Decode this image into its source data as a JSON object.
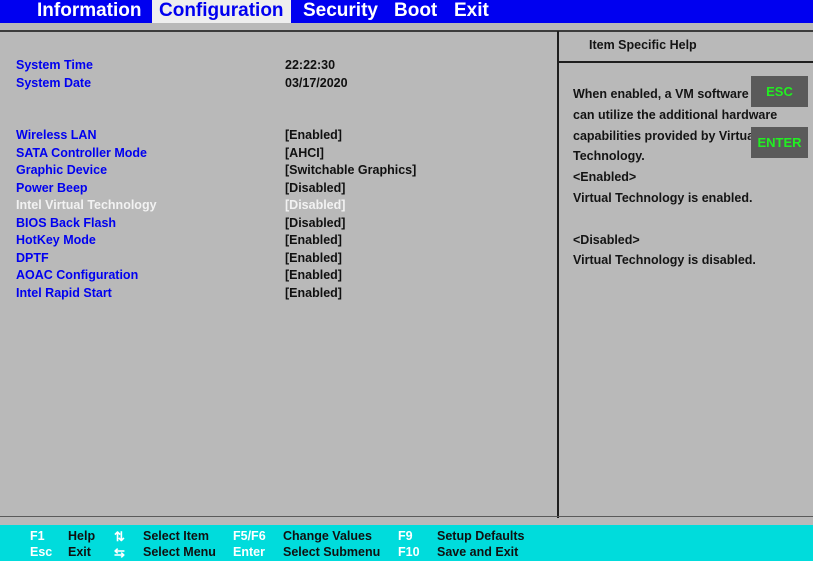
{
  "menu": {
    "tabs": [
      {
        "label": "Information",
        "active": false
      },
      {
        "label": "Configuration",
        "active": true
      },
      {
        "label": "Security",
        "active": false
      },
      {
        "label": "Boot",
        "active": false
      },
      {
        "label": "Exit",
        "active": false
      }
    ]
  },
  "settings": [
    {
      "label": "System Time",
      "value": "22:22:30",
      "selected": false
    },
    {
      "label": "System Date",
      "value": "03/17/2020",
      "selected": false
    },
    {
      "label": "Wireless LAN",
      "value": "[Enabled]",
      "selected": false
    },
    {
      "label": "SATA Controller Mode",
      "value": "[AHCI]",
      "selected": false
    },
    {
      "label": "Graphic Device",
      "value": "[Switchable Graphics]",
      "selected": false
    },
    {
      "label": "Power Beep",
      "value": "[Disabled]",
      "selected": false
    },
    {
      "label": "Intel Virtual Technology",
      "value": "[Disabled]",
      "selected": true
    },
    {
      "label": "BIOS Back Flash",
      "value": "[Disabled]",
      "selected": false
    },
    {
      "label": "HotKey Mode",
      "value": "[Enabled]",
      "selected": false
    },
    {
      "label": "DPTF",
      "value": "[Enabled]",
      "selected": false
    },
    {
      "label": "AOAC Configuration",
      "value": "[Enabled]",
      "selected": false
    },
    {
      "label": "Intel Rapid Start",
      "value": "[Enabled]",
      "selected": false
    }
  ],
  "help": {
    "title": "Item Specific Help",
    "lines": [
      "When enabled, a VM software",
      "can utilize the additional hardware",
      "capabilities provided by Virtual",
      "Technology.",
      "<Enabled>",
      "Virtual Technology is enabled.",
      "",
      "<Disabled>",
      "Virtual Technology is disabled."
    ]
  },
  "overlay_buttons": {
    "esc": "ESC",
    "enter": "ENTER"
  },
  "footer": {
    "row1": [
      {
        "key": "F1",
        "desc": "Help"
      },
      {
        "icon": "up-down-arrows-icon",
        "glyph": "⇅",
        "desc": "Select Item"
      },
      {
        "key": "F5/F6",
        "desc": "Change Values"
      },
      {
        "key": "F9",
        "desc": "Setup Defaults"
      }
    ],
    "row2": [
      {
        "key": "Esc",
        "desc": "Exit"
      },
      {
        "icon": "left-right-arrows-icon",
        "glyph": "⇆",
        "desc": "Select Menu"
      },
      {
        "key": "Enter",
        "desc": "Select Submenu"
      },
      {
        "key": "F10",
        "desc": "Save and Exit"
      }
    ]
  },
  "colors": {
    "menubar": "#0000f0",
    "background": "#b9b9b9",
    "label": "#0000f0",
    "selected": "#f2f2f2",
    "footer": "#00dcdc",
    "overlay_button_text": "#22ee22"
  }
}
